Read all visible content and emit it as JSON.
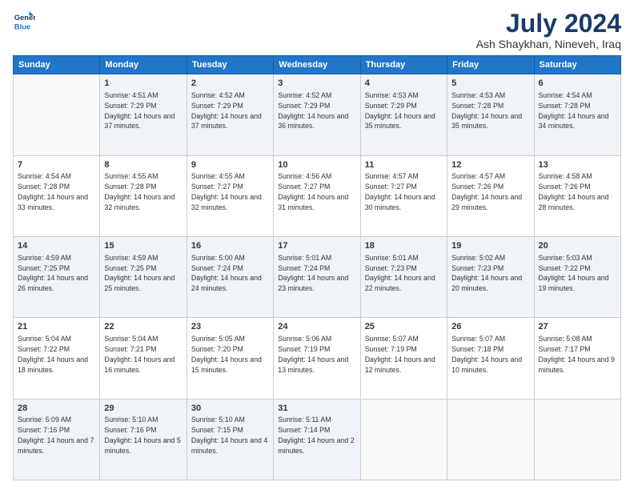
{
  "logo": {
    "line1": "General",
    "line2": "Blue"
  },
  "title": {
    "month_year": "July 2024",
    "location": "Ash Shaykhan, Nineveh, Iraq"
  },
  "days_header": [
    "Sunday",
    "Monday",
    "Tuesday",
    "Wednesday",
    "Thursday",
    "Friday",
    "Saturday"
  ],
  "weeks": [
    [
      {
        "day": "",
        "sunrise": "",
        "sunset": "",
        "daylight": ""
      },
      {
        "day": "1",
        "sunrise": "Sunrise: 4:51 AM",
        "sunset": "Sunset: 7:29 PM",
        "daylight": "Daylight: 14 hours and 37 minutes."
      },
      {
        "day": "2",
        "sunrise": "Sunrise: 4:52 AM",
        "sunset": "Sunset: 7:29 PM",
        "daylight": "Daylight: 14 hours and 37 minutes."
      },
      {
        "day": "3",
        "sunrise": "Sunrise: 4:52 AM",
        "sunset": "Sunset: 7:29 PM",
        "daylight": "Daylight: 14 hours and 36 minutes."
      },
      {
        "day": "4",
        "sunrise": "Sunrise: 4:53 AM",
        "sunset": "Sunset: 7:29 PM",
        "daylight": "Daylight: 14 hours and 35 minutes."
      },
      {
        "day": "5",
        "sunrise": "Sunrise: 4:53 AM",
        "sunset": "Sunset: 7:28 PM",
        "daylight": "Daylight: 14 hours and 35 minutes."
      },
      {
        "day": "6",
        "sunrise": "Sunrise: 4:54 AM",
        "sunset": "Sunset: 7:28 PM",
        "daylight": "Daylight: 14 hours and 34 minutes."
      }
    ],
    [
      {
        "day": "7",
        "sunrise": "Sunrise: 4:54 AM",
        "sunset": "Sunset: 7:28 PM",
        "daylight": "Daylight: 14 hours and 33 minutes."
      },
      {
        "day": "8",
        "sunrise": "Sunrise: 4:55 AM",
        "sunset": "Sunset: 7:28 PM",
        "daylight": "Daylight: 14 hours and 32 minutes."
      },
      {
        "day": "9",
        "sunrise": "Sunrise: 4:55 AM",
        "sunset": "Sunset: 7:27 PM",
        "daylight": "Daylight: 14 hours and 32 minutes."
      },
      {
        "day": "10",
        "sunrise": "Sunrise: 4:56 AM",
        "sunset": "Sunset: 7:27 PM",
        "daylight": "Daylight: 14 hours and 31 minutes."
      },
      {
        "day": "11",
        "sunrise": "Sunrise: 4:57 AM",
        "sunset": "Sunset: 7:27 PM",
        "daylight": "Daylight: 14 hours and 30 minutes."
      },
      {
        "day": "12",
        "sunrise": "Sunrise: 4:57 AM",
        "sunset": "Sunset: 7:26 PM",
        "daylight": "Daylight: 14 hours and 29 minutes."
      },
      {
        "day": "13",
        "sunrise": "Sunrise: 4:58 AM",
        "sunset": "Sunset: 7:26 PM",
        "daylight": "Daylight: 14 hours and 28 minutes."
      }
    ],
    [
      {
        "day": "14",
        "sunrise": "Sunrise: 4:59 AM",
        "sunset": "Sunset: 7:25 PM",
        "daylight": "Daylight: 14 hours and 26 minutes."
      },
      {
        "day": "15",
        "sunrise": "Sunrise: 4:59 AM",
        "sunset": "Sunset: 7:25 PM",
        "daylight": "Daylight: 14 hours and 25 minutes."
      },
      {
        "day": "16",
        "sunrise": "Sunrise: 5:00 AM",
        "sunset": "Sunset: 7:24 PM",
        "daylight": "Daylight: 14 hours and 24 minutes."
      },
      {
        "day": "17",
        "sunrise": "Sunrise: 5:01 AM",
        "sunset": "Sunset: 7:24 PM",
        "daylight": "Daylight: 14 hours and 23 minutes."
      },
      {
        "day": "18",
        "sunrise": "Sunrise: 5:01 AM",
        "sunset": "Sunset: 7:23 PM",
        "daylight": "Daylight: 14 hours and 22 minutes."
      },
      {
        "day": "19",
        "sunrise": "Sunrise: 5:02 AM",
        "sunset": "Sunset: 7:23 PM",
        "daylight": "Daylight: 14 hours and 20 minutes."
      },
      {
        "day": "20",
        "sunrise": "Sunrise: 5:03 AM",
        "sunset": "Sunset: 7:22 PM",
        "daylight": "Daylight: 14 hours and 19 minutes."
      }
    ],
    [
      {
        "day": "21",
        "sunrise": "Sunrise: 5:04 AM",
        "sunset": "Sunset: 7:22 PM",
        "daylight": "Daylight: 14 hours and 18 minutes."
      },
      {
        "day": "22",
        "sunrise": "Sunrise: 5:04 AM",
        "sunset": "Sunset: 7:21 PM",
        "daylight": "Daylight: 14 hours and 16 minutes."
      },
      {
        "day": "23",
        "sunrise": "Sunrise: 5:05 AM",
        "sunset": "Sunset: 7:20 PM",
        "daylight": "Daylight: 14 hours and 15 minutes."
      },
      {
        "day": "24",
        "sunrise": "Sunrise: 5:06 AM",
        "sunset": "Sunset: 7:19 PM",
        "daylight": "Daylight: 14 hours and 13 minutes."
      },
      {
        "day": "25",
        "sunrise": "Sunrise: 5:07 AM",
        "sunset": "Sunset: 7:19 PM",
        "daylight": "Daylight: 14 hours and 12 minutes."
      },
      {
        "day": "26",
        "sunrise": "Sunrise: 5:07 AM",
        "sunset": "Sunset: 7:18 PM",
        "daylight": "Daylight: 14 hours and 10 minutes."
      },
      {
        "day": "27",
        "sunrise": "Sunrise: 5:08 AM",
        "sunset": "Sunset: 7:17 PM",
        "daylight": "Daylight: 14 hours and 9 minutes."
      }
    ],
    [
      {
        "day": "28",
        "sunrise": "Sunrise: 5:09 AM",
        "sunset": "Sunset: 7:16 PM",
        "daylight": "Daylight: 14 hours and 7 minutes."
      },
      {
        "day": "29",
        "sunrise": "Sunrise: 5:10 AM",
        "sunset": "Sunset: 7:16 PM",
        "daylight": "Daylight: 14 hours and 5 minutes."
      },
      {
        "day": "30",
        "sunrise": "Sunrise: 5:10 AM",
        "sunset": "Sunset: 7:15 PM",
        "daylight": "Daylight: 14 hours and 4 minutes."
      },
      {
        "day": "31",
        "sunrise": "Sunrise: 5:11 AM",
        "sunset": "Sunset: 7:14 PM",
        "daylight": "Daylight: 14 hours and 2 minutes."
      },
      {
        "day": "",
        "sunrise": "",
        "sunset": "",
        "daylight": ""
      },
      {
        "day": "",
        "sunrise": "",
        "sunset": "",
        "daylight": ""
      },
      {
        "day": "",
        "sunrise": "",
        "sunset": "",
        "daylight": ""
      }
    ]
  ]
}
